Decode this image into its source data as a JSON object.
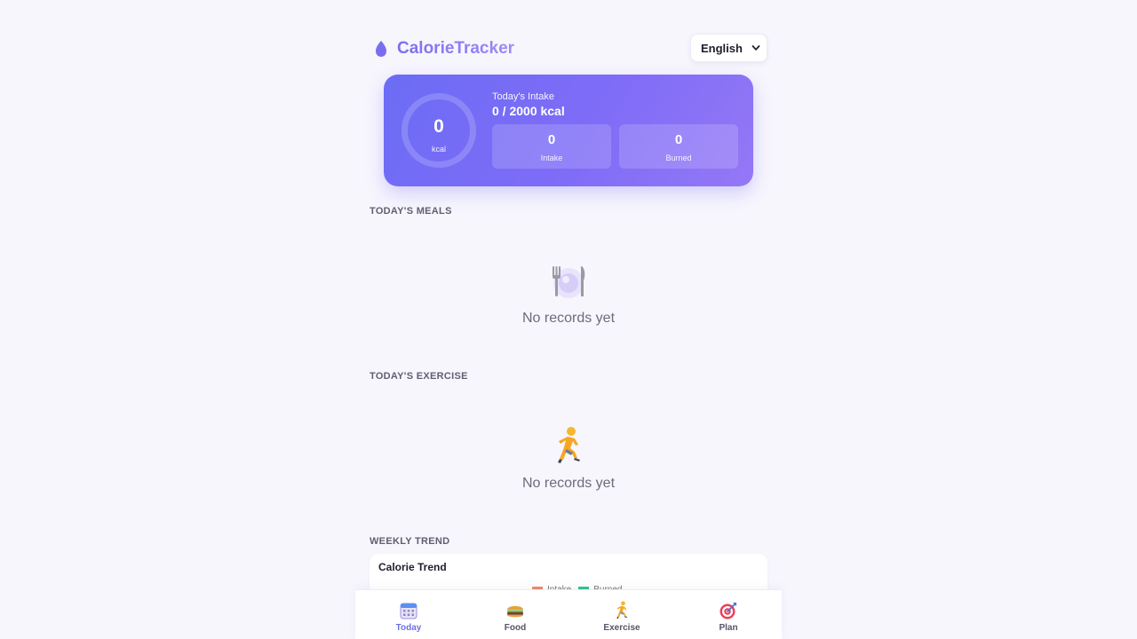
{
  "header": {
    "logo_icon": "flame-icon",
    "app_name": "CalorieTracker",
    "language": "English"
  },
  "summary": {
    "ring_value": "0",
    "ring_unit": "kcal",
    "intake_label": "Today's Intake",
    "intake_value": "0 / 2000 kcal",
    "intake_box": {
      "value": "0",
      "label": "Intake"
    },
    "burned_box": {
      "value": "0",
      "label": "Burned"
    }
  },
  "meals": {
    "title": "Today's Meals",
    "empty_icon": "plate-fork-knife-icon",
    "empty_text": "No records yet"
  },
  "exercise": {
    "title": "Today's Exercise",
    "empty_icon": "running-person-icon",
    "empty_text": "No records yet"
  },
  "trend": {
    "section_title": "Weekly Trend",
    "card_title": "Calorie Trend",
    "legend": [
      {
        "name": "Intake",
        "color": "#f08a6a"
      },
      {
        "name": "Burned",
        "color": "#34c38f"
      }
    ]
  },
  "nav": [
    {
      "label": "Today",
      "icon": "calendar-icon",
      "active": true
    },
    {
      "label": "Food",
      "icon": "burger-icon",
      "active": false
    },
    {
      "label": "Exercise",
      "icon": "running-person-icon",
      "active": false
    },
    {
      "label": "Plan",
      "icon": "target-icon",
      "active": false
    }
  ],
  "colors": {
    "accent": "#6f6ee8",
    "card_gradient_start": "#6c6cf5",
    "card_gradient_end": "#9478f6",
    "background": "#f7f6fd"
  }
}
